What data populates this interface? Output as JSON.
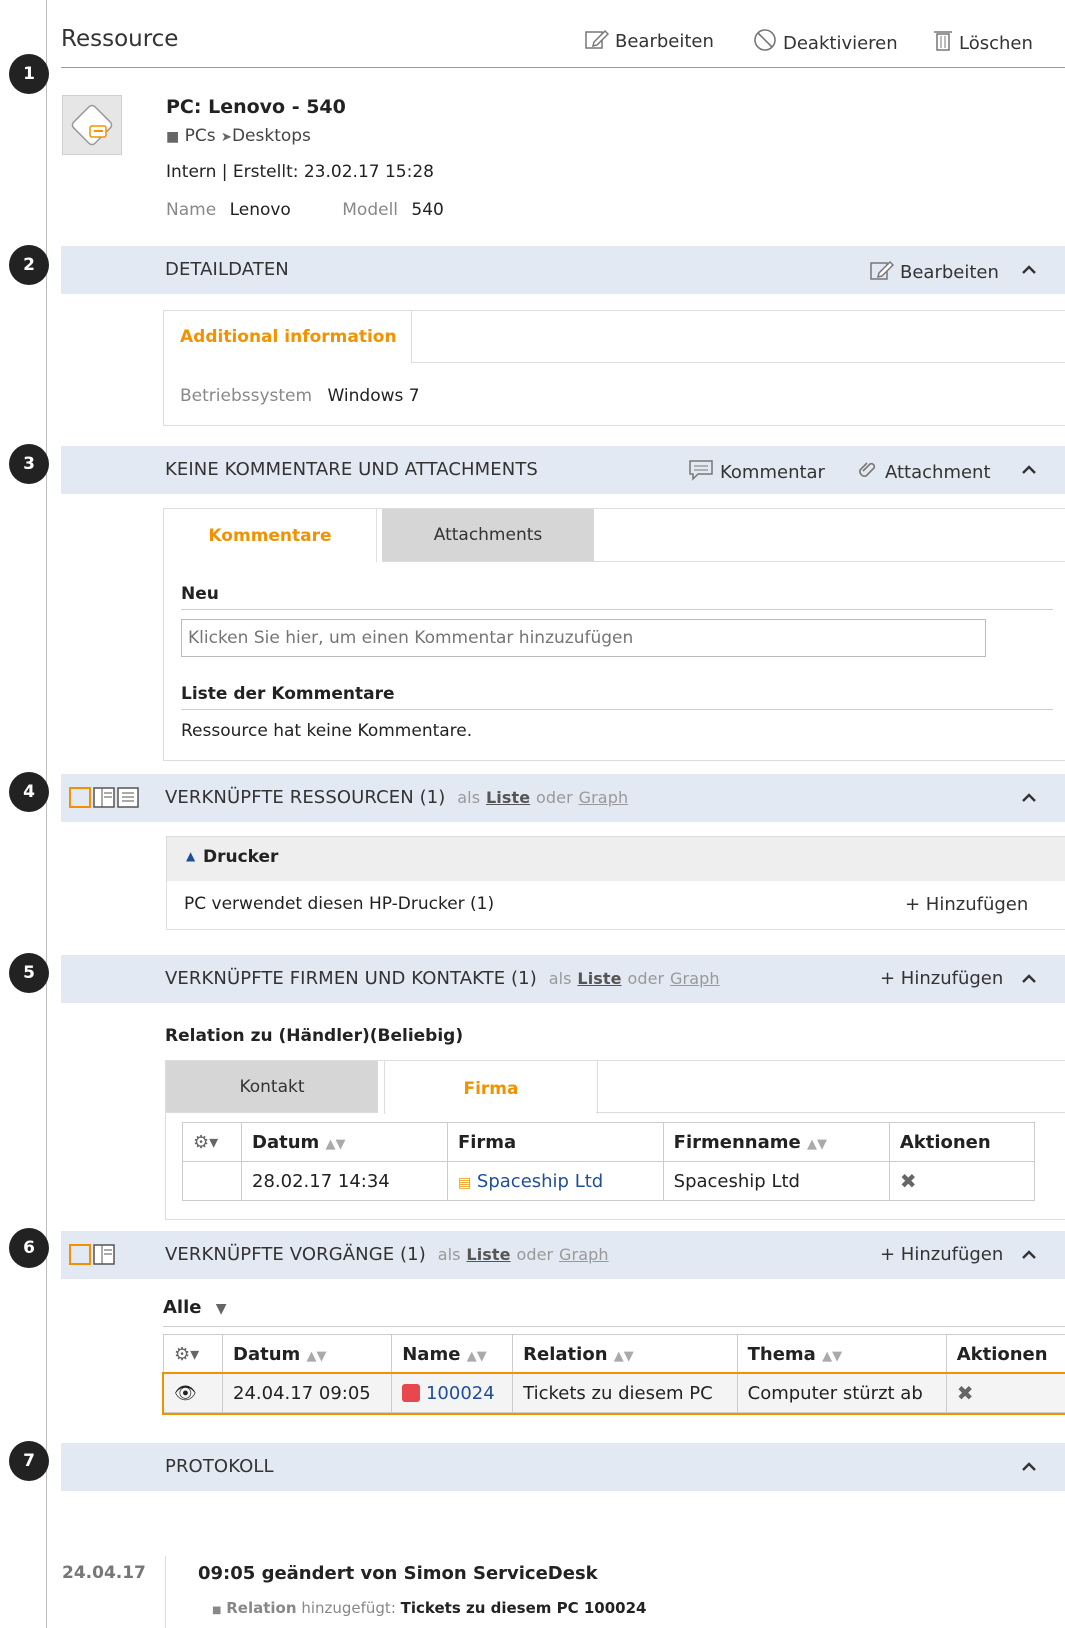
{
  "header": {
    "title": "Ressource",
    "actions": {
      "edit": "Bearbeiten",
      "deactivate": "Deaktivieren",
      "delete": "Löschen"
    }
  },
  "badges": [
    "1",
    "2",
    "3",
    "4",
    "5",
    "6",
    "7"
  ],
  "resource": {
    "name": "PC: Lenovo - 540",
    "category1": "PCs",
    "category2": "Desktops",
    "meta": "Intern | Erstellt: 23.02.17 15:28",
    "name_label": "Name",
    "name_value": "Lenovo",
    "model_label": "Modell",
    "model_value": "540"
  },
  "details": {
    "heading": "DETAILDATEN",
    "edit": "Bearbeiten",
    "tab": "Additional information",
    "os_label": "Betriebssystem",
    "os_value": "Windows 7"
  },
  "comments": {
    "heading": "KEINE KOMMENTARE UND ATTACHMENTS",
    "comment_action": "Kommentar",
    "attachment_action": "Attachment",
    "tab_comments": "Kommentare",
    "tab_attachments": "Attachments",
    "new_label": "Neu",
    "placeholder": "Klicken Sie hier, um einen Kommentar hinzuzufügen",
    "list_label": "Liste der Kommentare",
    "empty": "Ressource hat keine Kommentare."
  },
  "linked_resources": {
    "heading": "VERKNÜPFTE RESSOURCEN (1)",
    "as": "als",
    "list": "Liste",
    "or": "oder",
    "graph": "Graph",
    "group": "Drucker",
    "row": "PC verwendet diesen HP-Drucker (1)",
    "add": "+ Hinzufügen"
  },
  "linked_companies": {
    "heading": "VERKNÜPFTE FIRMEN UND KONTAKTE (1)",
    "as": "als",
    "list": "Liste",
    "or": "oder",
    "graph": "Graph",
    "add": "+ Hinzufügen",
    "relation": "Relation zu (Händler)(Beliebig)",
    "tab_contact": "Kontakt",
    "tab_company": "Firma",
    "columns": [
      "Datum",
      "Firma",
      "Firmenname",
      "Aktionen"
    ],
    "rows": [
      {
        "date": "28.02.17 14:34",
        "company": "Spaceship Ltd",
        "company_name": "Spaceship Ltd"
      }
    ]
  },
  "linked_tickets": {
    "heading": "VERKNÜPFTE VORGÄNGE (1)",
    "as": "als",
    "list": "Liste",
    "or": "oder",
    "graph": "Graph",
    "add": "+ Hinzufügen",
    "filter": "Alle",
    "columns": [
      "Datum",
      "Name",
      "Relation",
      "Thema",
      "Aktionen"
    ],
    "rows": [
      {
        "date": "24.04.17 09:05",
        "name": "100024",
        "relation": "Tickets zu diesem PC",
        "topic": "Computer stürzt ab"
      }
    ]
  },
  "protocol": {
    "heading": "PROTOKOLL",
    "date": "24.04.17",
    "entry_title": "09:05 geändert von Simon ServiceDesk",
    "entry_item_label": "Relation",
    "entry_item_verb": "hinzugefügt:",
    "entry_item_value": "Tickets zu diesem PC 100024"
  },
  "colors": {
    "accent": "#f39200",
    "band": "#e3e9f2",
    "link": "#1f4e9a"
  }
}
